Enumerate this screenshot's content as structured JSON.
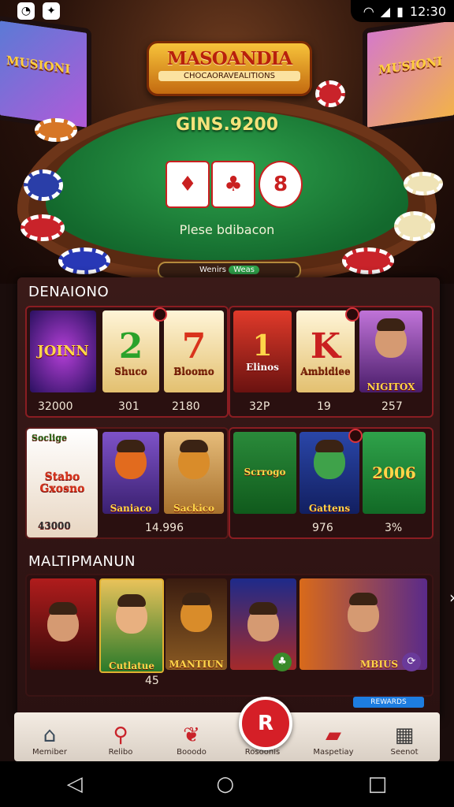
{
  "status_bar": {
    "time": "12:30",
    "left_icons": [
      "app-notification-icon",
      "camera-icon"
    ],
    "right_icons": [
      "wifi-icon",
      "signal-icon",
      "battery-icon"
    ]
  },
  "hero": {
    "logo_title": "MASOANDIA",
    "logo_subtitle": "CHOCAORAVEALITIONS",
    "left_screen_text": "MUSIONI",
    "right_screen_text": "MUSIONI",
    "balance": "GINS.9200",
    "felt_label": "Plese bdibacon",
    "bottom_pill_label": "Wenirs",
    "bottom_pill_value": "Weas",
    "cards": [
      "♦",
      "♣",
      "8"
    ]
  },
  "sections": {
    "featured_title": "DENAIONO",
    "featured_row1": [
      {
        "label": "JOINN",
        "value": "32000"
      },
      {
        "label": "Shuco",
        "big": "2",
        "value": "301"
      },
      {
        "label": "Bloomo",
        "big": "7",
        "value": "2180"
      },
      {
        "label": "Elinos",
        "big": "1",
        "value": "32P"
      },
      {
        "label": "Ambidiee",
        "big": "K",
        "value": "19"
      },
      {
        "label": "NIGITOX",
        "value": "257"
      }
    ],
    "featured_row2": [
      {
        "label": "Stabo Gxosno",
        "tag": "Soclige",
        "value": "43000"
      },
      {
        "label": "Saniaco",
        "value": ""
      },
      {
        "label": "Sackico",
        "value": "14.996"
      },
      {
        "label": "Scrrogo",
        "value": ""
      },
      {
        "label": "Gattens",
        "value": "976"
      },
      {
        "label": "2006",
        "value": "3%"
      }
    ],
    "multiplayer_title": "MALTIPMANUN",
    "multiplayer_row": [
      {
        "label": ""
      },
      {
        "label": "Cutlatue"
      },
      {
        "label": "MANTIUN"
      },
      {
        "label": ""
      },
      {
        "label": ""
      },
      {
        "label": "MBIUS"
      }
    ],
    "multiplayer_count": "45",
    "blue_strip": "REWARDS"
  },
  "nav": {
    "items": [
      {
        "label": "Memiber",
        "icon": "home-icon"
      },
      {
        "label": "Relibo",
        "icon": "joystick-icon"
      },
      {
        "label": "Booodo",
        "icon": "gift-icon"
      },
      {
        "label": "Rosoonis",
        "icon": "center-logo-icon"
      },
      {
        "label": "Maspetiay",
        "icon": "cards-icon"
      },
      {
        "label": "Seenot",
        "icon": "calendar-icon"
      }
    ]
  },
  "colors": {
    "accent_red": "#d51f27",
    "felt_green": "#1f8a3a",
    "gold": "#f7c33a"
  }
}
